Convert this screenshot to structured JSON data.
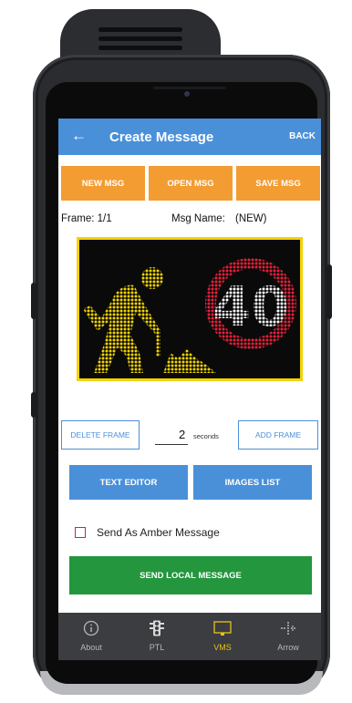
{
  "app_bar": {
    "back_arrow": "←",
    "title": "Create Message",
    "back_label": "BACK"
  },
  "toolbar": {
    "new_label": "NEW MSG",
    "open_label": "OPEN MSG",
    "save_label": "SAVE MSG"
  },
  "info": {
    "frame_label": "Frame: 1/1",
    "msg_name_label": "Msg Name:",
    "msg_name_value": "(NEW)"
  },
  "sign": {
    "icon": "roadworks-man-icon",
    "speed_value": "40",
    "frame_color": "#f2d300",
    "man_color": "#f2d300",
    "ring_color": "#e8203a",
    "digit_color": "#ffffff"
  },
  "frame_controls": {
    "delete_label": "DELETE FRAME",
    "duration_value": "2",
    "duration_unit": "seconds",
    "add_label": "ADD FRAME"
  },
  "editors": {
    "text_editor_label": "TEXT EDITOR",
    "images_list_label": "IMAGES LIST"
  },
  "amber": {
    "label": "Send As Amber Message",
    "checked": false
  },
  "send": {
    "label": "SEND LOCAL MESSAGE"
  },
  "nav": {
    "items": [
      {
        "label": "About",
        "icon": "info-icon"
      },
      {
        "label": "PTL",
        "icon": "traffic-light-icon"
      },
      {
        "label": "VMS",
        "icon": "vms-screen-icon",
        "active": true
      },
      {
        "label": "Arrow",
        "icon": "arrow-board-icon"
      }
    ],
    "active_color": "#e8c21a"
  },
  "colors": {
    "primary": "#4a90d9",
    "accent": "#f39c32",
    "success": "#23963e"
  }
}
